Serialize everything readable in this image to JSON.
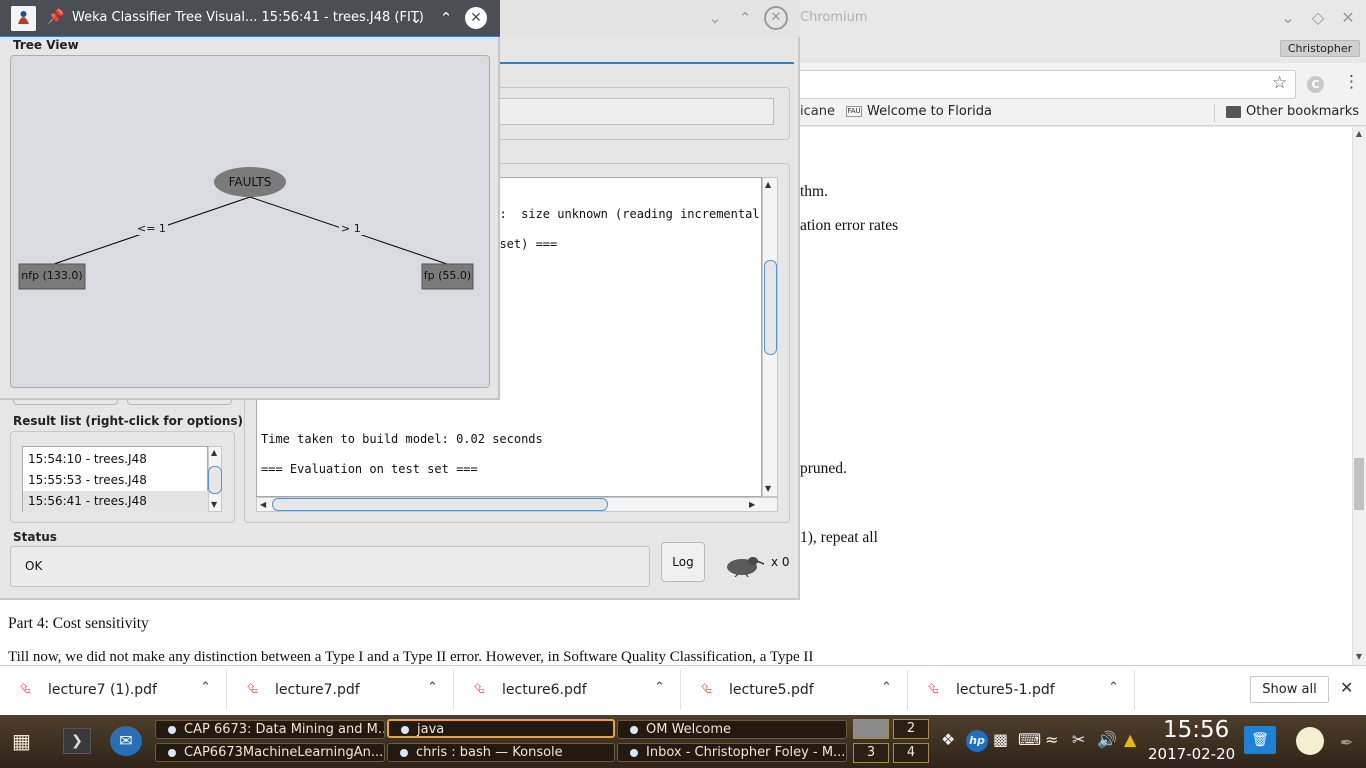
{
  "chrome": {
    "title": "Chromium",
    "profile": "Christopher",
    "bookmarks": [
      {
        "label": "icane"
      },
      {
        "label": "Welcome to Florida"
      }
    ],
    "bookmark_fau_icon": "FAU",
    "other_bookmarks": "Other bookmarks",
    "ext_letter": "C",
    "page_lines": [
      "thm.",
      "ation error rates",
      "pruned.",
      "1), repeat all",
      "Part 4: Cost sensitivity",
      "Till now, we did not make any distinction between a Type I and a Type II error. However, in Software Quality Classification, a Type II"
    ],
    "downloads": [
      "lecture7 (1).pdf",
      "lecture7.pdf",
      "lecture6.pdf",
      "lecture5.pdf",
      "lecture5-1.pdf"
    ],
    "show_all": "Show all"
  },
  "explorer": {
    "output_lines": [
      "et:  size unknown (reading incremental",
      "g set) ===",
      "Time taken to build model: 0.02 seconds",
      "=== Evaluation on test set ==="
    ],
    "result_label": "Result list (right-click for options)",
    "results": [
      "15:54:10 - trees.J48",
      "15:55:53 - trees.J48",
      "15:56:41 - trees.J48"
    ],
    "status_label": "Status",
    "status_text": "OK",
    "log_label": "Log",
    "x_count": "x 0"
  },
  "tree_window": {
    "title": "Weka Classifier Tree Visual... 15:56:41 - trees.J48 (FIT)",
    "section_label": "Tree View",
    "root": "FAULTS",
    "edges": [
      "<= 1",
      "> 1"
    ],
    "leaves": [
      "nfp (133.0)",
      "fp (55.0)"
    ]
  },
  "taskbar": {
    "tasks_row1": [
      "CAP 6673: Data Mining and M...",
      "java",
      "OM Welcome"
    ],
    "tasks_row2": [
      "CAP6673MachineLearningAn...",
      "chris : bash — Konsole",
      "Inbox - Christopher Foley - M..."
    ],
    "pager": [
      "2",
      "3",
      "4"
    ],
    "time": "15:56",
    "date": "2017-02-20",
    "tray_hp": "hp"
  }
}
